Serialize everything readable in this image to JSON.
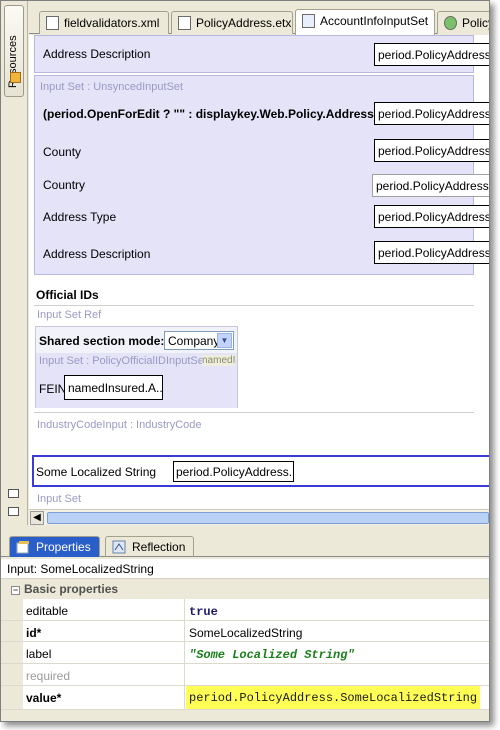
{
  "rail": {
    "resources_label": "Resources"
  },
  "tabs": [
    {
      "label": "fieldvalidators.xml",
      "active": false
    },
    {
      "label": "PolicyAddress.etx",
      "active": false
    },
    {
      "label": "AccountInfoInputSet",
      "active": true
    },
    {
      "label": "Policy",
      "active": false
    }
  ],
  "canvas": {
    "top_row": {
      "label": "Address Description",
      "value": "period.PolicyAddress.Ad"
    },
    "unsynced": {
      "header": "Input Set : UnsyncedInputSet",
      "rows": [
        {
          "label": "(period.OpenForEdit ? \"\" : displaykey.Web.Policy.Address)",
          "value": "period.PolicyAddress.D",
          "bold": true
        },
        {
          "label": "County",
          "value": "period.PolicyAddress.C"
        },
        {
          "label": "Country",
          "value": "period.PolicyAddress.C"
        },
        {
          "label": "Address Type",
          "value": "period.PolicyAddress.Ad"
        },
        {
          "label": "Address Description",
          "value": "period.PolicyAddress.D"
        }
      ]
    },
    "official_ids": {
      "title": "Official IDs",
      "ref_label": "Input Set Ref",
      "shared_mode_label": "Shared section mode:",
      "shared_mode_value": "Company",
      "inputset_label": "Input Set : PolicyOfficialIDInputSet",
      "inputset_tag": "namedI",
      "fein_label": "FEIN",
      "fein_value": "namedInsured.A..."
    },
    "industry_label": "IndustryCodeInput : IndustryCode",
    "localized": {
      "label": "Some Localized String",
      "value": "period.PolicyAddress...."
    },
    "bottom_label": "Input Set"
  },
  "panel": {
    "tabs": [
      {
        "label": "Properties",
        "active": true
      },
      {
        "label": "Reflection",
        "active": false
      }
    ],
    "header": "Input: SomeLocalizedString",
    "group": "Basic properties",
    "rows": [
      {
        "key": "editable",
        "value": "true",
        "style": "mono"
      },
      {
        "key": "id*",
        "value": "SomeLocalizedString",
        "style": "plain",
        "key_bold": true
      },
      {
        "key": "label",
        "value": "\"Some Localized String\"",
        "style": "green"
      },
      {
        "key": "required",
        "value": "",
        "style": "plain",
        "key_gray": true
      },
      {
        "key": "value*",
        "value": "period.PolicyAddress.SomeLocalizedString",
        "style": "highlight",
        "key_bold": true
      }
    ]
  },
  "colors": {
    "accent": "#2a5ec8",
    "inputset_bg": "#e4e3f8",
    "highlight": "#ffff55",
    "green_text": "#1a7f1a"
  }
}
